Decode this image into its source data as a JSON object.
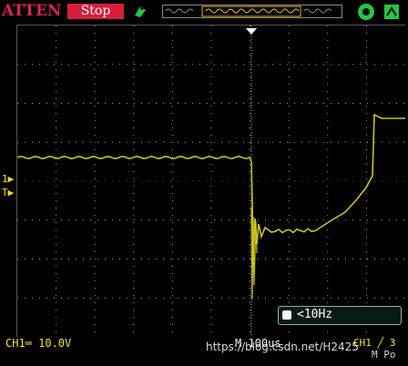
{
  "status": {
    "atten": "ATTEN",
    "run_state": "Stop"
  },
  "trigger": {
    "freq_readout": "<10Hz",
    "marker_channel": "1",
    "marker_trigger": "T"
  },
  "footer": {
    "ch1_scale": "CH1═ 10.0V",
    "timebase": "M 100us",
    "ch1_trigger": "CH1 ╱ 3",
    "mode": "M Po",
    "watermark": "https://blog.csdn.net/H2425"
  },
  "colors": {
    "trace": "#c9c31e",
    "grid": "#9a9a9a",
    "atten": "#e0224a",
    "stop_bg": "#d61f3a",
    "accent_green": "#25c445"
  },
  "icons": [
    "trigger-arrow-icon",
    "hold-icon",
    "waveform-limit-icon",
    "settings-gear-icon"
  ]
}
